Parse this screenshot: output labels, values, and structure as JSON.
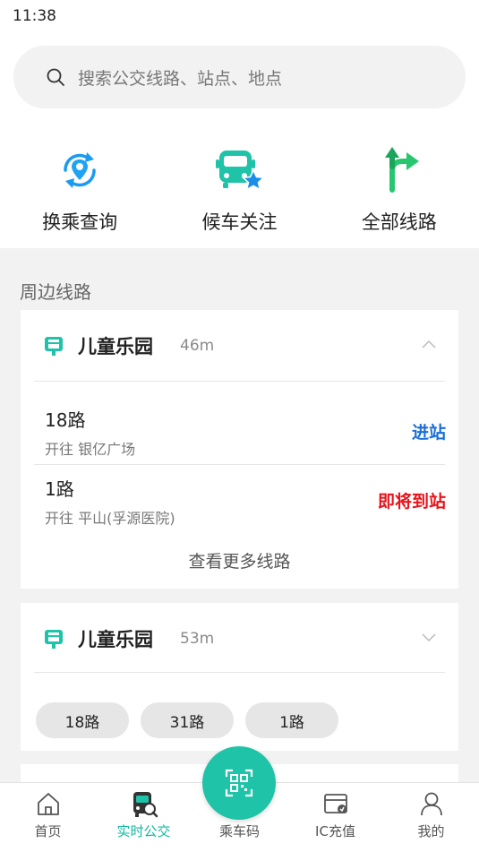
{
  "status_bar": {
    "time": "11:38"
  },
  "search": {
    "placeholder": "搜索公交线路、站点、地点"
  },
  "quick_actions": [
    {
      "label": "换乘查询",
      "icon": "location-transfer-icon"
    },
    {
      "label": "候车关注",
      "icon": "bus-star-icon"
    },
    {
      "label": "全部线路",
      "icon": "route-arrows-icon"
    }
  ],
  "section": {
    "title": "周边线路"
  },
  "stops": [
    {
      "name": "儿童乐园",
      "distance": "46m",
      "expanded": true,
      "lines": [
        {
          "name": "18路",
          "direction": "开往 银亿广场",
          "status": "进站",
          "status_color": "#1a6fd6"
        },
        {
          "name": "1路",
          "direction": "开往 平山(孚源医院)",
          "status": "即将到站",
          "status_color": "#e8141b"
        }
      ],
      "more_label": "查看更多线路"
    },
    {
      "name": "儿童乐园",
      "distance": "53m",
      "expanded": false,
      "chips": [
        "18路",
        "31路",
        "1路"
      ]
    }
  ],
  "tabbar": {
    "items": [
      {
        "label": "首页",
        "icon": "home-icon",
        "active": false
      },
      {
        "label": "实时公交",
        "icon": "bus-search-icon",
        "active": true
      },
      {
        "label": "乘车码",
        "icon": "qr-code-icon",
        "active": false
      },
      {
        "label": "IC充值",
        "icon": "card-recharge-icon",
        "active": false
      },
      {
        "label": "我的",
        "icon": "user-icon",
        "active": false
      }
    ]
  },
  "colors": {
    "accent": "#1fc3a7",
    "active_tab": "#12b7a0",
    "arriving": "#1a6fd6",
    "about_to_arrive": "#e8141b"
  }
}
